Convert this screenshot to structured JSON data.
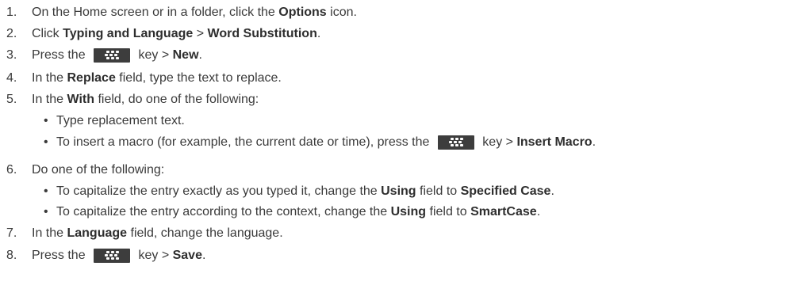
{
  "steps": [
    {
      "num": "1.",
      "parts": [
        {
          "t": "On the Home screen or in a folder, click the "
        },
        {
          "t": "Options",
          "b": true
        },
        {
          "t": " icon."
        }
      ]
    },
    {
      "num": "2.",
      "parts": [
        {
          "t": "Click "
        },
        {
          "t": "Typing and Language",
          "b": true
        },
        {
          "t": " > "
        },
        {
          "t": "Word Substitution",
          "b": true
        },
        {
          "t": "."
        }
      ]
    },
    {
      "num": "3.",
      "parts": [
        {
          "t": "Press the "
        },
        {
          "key": true
        },
        {
          "t": " key > "
        },
        {
          "t": "New",
          "b": true
        },
        {
          "t": "."
        }
      ]
    },
    {
      "num": "4.",
      "parts": [
        {
          "t": "In the "
        },
        {
          "t": "Replace",
          "b": true
        },
        {
          "t": " field, type the text to replace."
        }
      ]
    },
    {
      "num": "5.",
      "parts": [
        {
          "t": "In the "
        },
        {
          "t": "With",
          "b": true
        },
        {
          "t": " field, do one of the following:"
        }
      ]
    },
    {
      "bullet": "•",
      "parts": [
        {
          "t": "Type replacement text."
        }
      ]
    },
    {
      "bullet": "•",
      "parts": [
        {
          "t": "To insert a macro (for example, the current date or time), press the "
        },
        {
          "key": true
        },
        {
          "t": " key > "
        },
        {
          "t": "Insert Macro",
          "b": true
        },
        {
          "t": "."
        }
      ]
    },
    {
      "num": "6.",
      "parts": [
        {
          "t": "Do one of the following:"
        }
      ]
    },
    {
      "bullet": "•",
      "parts": [
        {
          "t": "To capitalize the entry exactly as you typed it, change the "
        },
        {
          "t": "Using",
          "b": true
        },
        {
          "t": " field to "
        },
        {
          "t": "Specified Case",
          "b": true
        },
        {
          "t": "."
        }
      ]
    },
    {
      "bullet": "•",
      "parts": [
        {
          "t": "To capitalize the entry according to the context, change the "
        },
        {
          "t": "Using",
          "b": true
        },
        {
          "t": " field to "
        },
        {
          "t": "SmartCase",
          "b": true
        },
        {
          "t": "."
        }
      ]
    },
    {
      "num": "7.",
      "parts": [
        {
          "t": "In the "
        },
        {
          "t": "Language",
          "b": true
        },
        {
          "t": " field, change the language."
        }
      ]
    },
    {
      "num": "8.",
      "parts": [
        {
          "t": "Press the "
        },
        {
          "key": true
        },
        {
          "t": " key > "
        },
        {
          "t": "Save",
          "b": true
        },
        {
          "t": "."
        }
      ]
    }
  ],
  "icons": {
    "menu_key": "blackberry-menu-key-icon"
  },
  "colors": {
    "text": "#3a3a3a",
    "key_bg": "#3d3d3d"
  }
}
